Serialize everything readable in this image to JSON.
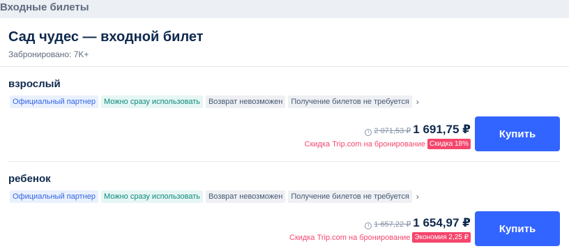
{
  "section": {
    "title": "Входные билеты"
  },
  "product": {
    "title": "Сад чудес — входной билет",
    "booked": "Забронировано: 7K+"
  },
  "tickets": [
    {
      "name": "взрослый",
      "tags": [
        "Официальный партнер",
        "Можно сразу использовать",
        "Возврат невозможен",
        "Получение билетов не требуется"
      ],
      "more_icon": "chevron-right-icon",
      "info_icon": "info-icon",
      "old_price": "2 071,53 ₽",
      "new_price": "1 691,75 ₽",
      "discount_text": "Скидка Trip.com на бронирование",
      "discount_badge": "Скидка 18%",
      "buy_label": "Купить"
    },
    {
      "name": "ребенок",
      "tags": [
        "Официальный партнер",
        "Можно сразу использовать",
        "Возврат невозможен",
        "Получение билетов не требуется"
      ],
      "more_icon": "chevron-right-icon",
      "info_icon": "info-icon",
      "old_price": "1 657,22 ₽",
      "new_price": "1 654,97 ₽",
      "discount_text": "Скидка Trip.com на бронирование",
      "discount_badge": "Экономия 2,25 ₽",
      "buy_label": "Купить"
    }
  ],
  "colors": {
    "accent": "#3264ff",
    "discount": "#f5466c",
    "text": "#0f294d"
  }
}
